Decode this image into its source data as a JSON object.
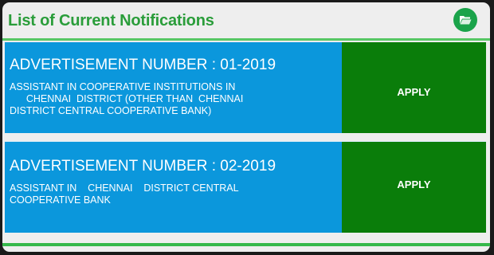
{
  "panel": {
    "title": "List of Current Notifications",
    "header_icon": "folder-open-icon",
    "colors": {
      "title": "#2a9d3a",
      "rule": "#57c765",
      "row_info": "#0b97dc",
      "row_apply": "#0a7d0a",
      "icon_bg": "#1aa34a"
    }
  },
  "notifications": [
    {
      "title": "ADVERTISEMENT NUMBER : 01-2019",
      "description": "ASSISTANT IN COOPERATIVE INSTITUTIONS IN\n      CHENNAI  DISTRICT (OTHER THAN  CHENNAI\nDISTRICT CENTRAL COOPERATIVE BANK)",
      "action_label": "APPLY"
    },
    {
      "title": "ADVERTISEMENT NUMBER : 02-2019",
      "description": "ASSISTANT IN    CHENNAI    DISTRICT CENTRAL\nCOOPERATIVE BANK",
      "action_label": "APPLY"
    }
  ]
}
